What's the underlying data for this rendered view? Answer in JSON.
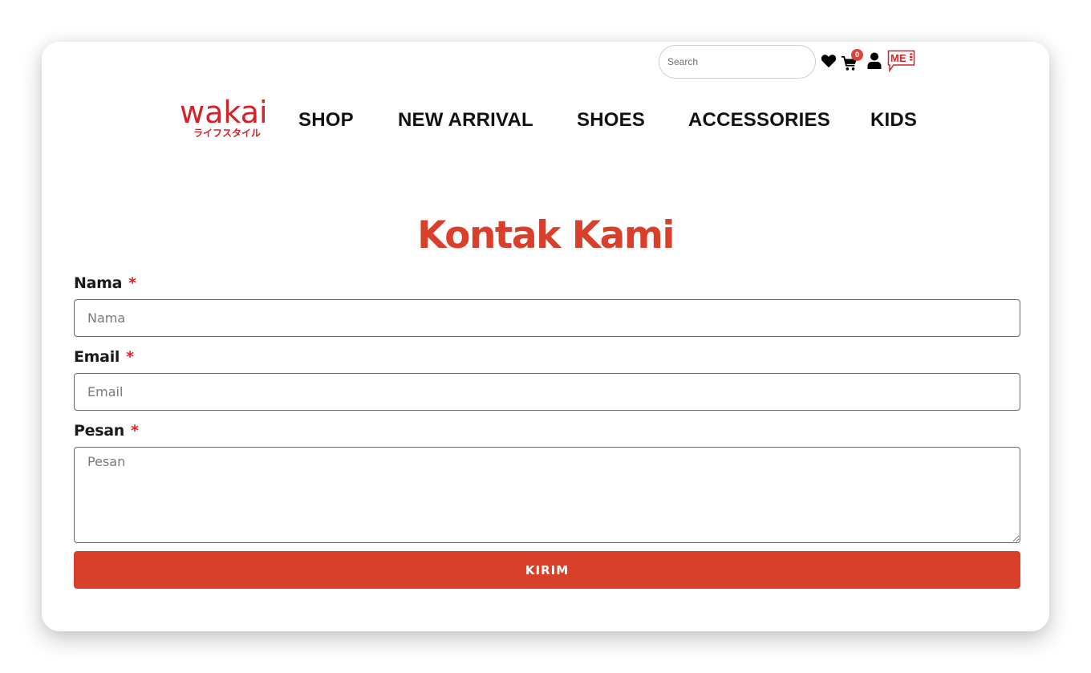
{
  "header": {
    "search_placeholder": "Search",
    "cart_count": "0",
    "mei_label": "ME",
    "logo": {
      "word": "wakai",
      "kana": "ライフスタイル"
    },
    "icons": [
      "heart-icon",
      "cart-icon",
      "user-icon",
      "mei-chat-icon"
    ]
  },
  "nav": {
    "items": [
      {
        "label": "SHOP"
      },
      {
        "label": "NEW ARRIVAL"
      },
      {
        "label": "SHOES"
      },
      {
        "label": "ACCESSORIES"
      },
      {
        "label": "KIDS"
      }
    ]
  },
  "page": {
    "title": "Kontak Kami"
  },
  "form": {
    "required_marker": "*",
    "fields": [
      {
        "label": "Nama",
        "placeholder": "Nama",
        "value": ""
      },
      {
        "label": "Email",
        "placeholder": "Email",
        "value": ""
      },
      {
        "label": "Pesan",
        "placeholder": "Pesan",
        "value": ""
      }
    ],
    "submit_label": "KIRIM"
  },
  "colors": {
    "brand_red": "#d2232a",
    "accent": "#d9402c",
    "badge": "#d9453b",
    "text": "#111111"
  }
}
